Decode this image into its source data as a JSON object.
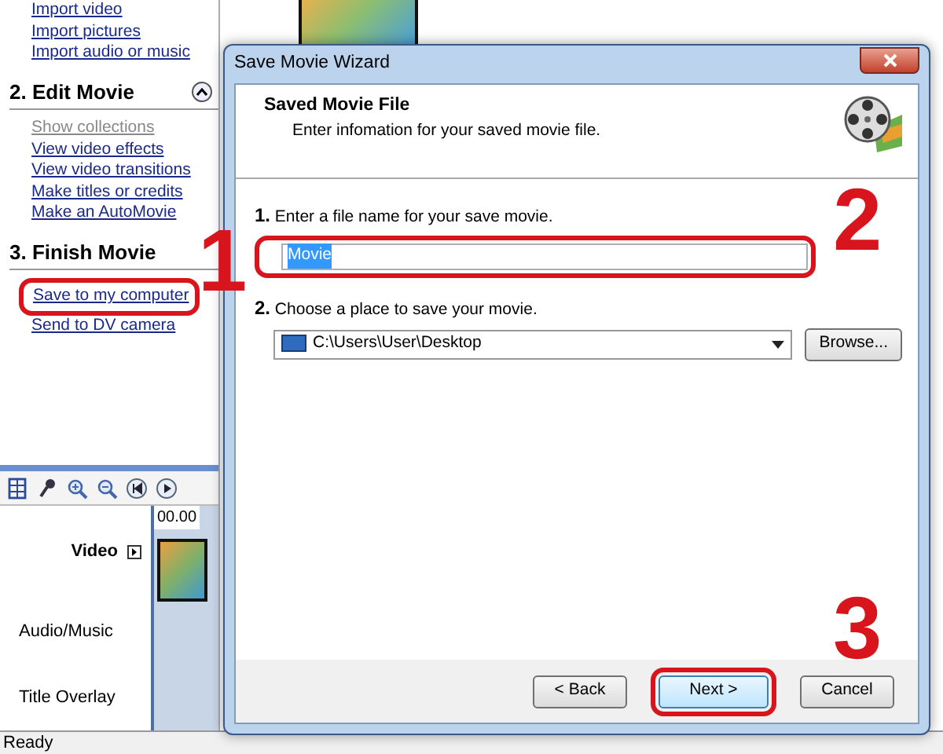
{
  "task_pane": {
    "sections": [
      {
        "items": [
          {
            "label": "Import video",
            "disabled": false,
            "highlighted": false
          },
          {
            "label": "Import pictures",
            "disabled": false,
            "highlighted": false
          },
          {
            "label": "Import audio or music",
            "disabled": false,
            "highlighted": false
          }
        ]
      },
      {
        "title": "2. Edit Movie",
        "collapsible": true,
        "items": [
          {
            "label": "Show collections",
            "disabled": true,
            "highlighted": false
          },
          {
            "label": "View video effects",
            "disabled": false,
            "highlighted": false
          },
          {
            "label": "View video transitions",
            "disabled": false,
            "highlighted": false
          },
          {
            "label": "Make titles or credits",
            "disabled": false,
            "highlighted": false
          },
          {
            "label": "Make an AutoMovie",
            "disabled": false,
            "highlighted": false
          }
        ]
      },
      {
        "title": "3. Finish Movie",
        "collapsible": false,
        "items": [
          {
            "label": "Save to my computer",
            "disabled": false,
            "highlighted": true
          },
          {
            "label": "Send to DV camera",
            "disabled": false,
            "highlighted": false
          }
        ]
      }
    ]
  },
  "timeline": {
    "time": "00.00",
    "tracks": [
      {
        "label": "Video",
        "bold": true,
        "expandable": true,
        "has_clip": true
      },
      {
        "label": "Audio/Music",
        "bold": false,
        "expandable": false,
        "has_clip": false
      },
      {
        "label": "Title Overlay",
        "bold": false,
        "expandable": false,
        "has_clip": false
      }
    ]
  },
  "status_bar": "Ready",
  "dialog": {
    "title": "Save Movie Wizard",
    "header_title": "Saved Movie File",
    "header_subtitle": "Enter infomation for your saved movie file.",
    "steps": [
      {
        "number": "1.",
        "label": "Enter a file name for your save movie.",
        "kind": "text",
        "value": "Movie",
        "text_selected": true,
        "highlighted": true
      },
      {
        "number": "2.",
        "label": "Choose a place to save your movie.",
        "kind": "dropdown",
        "value": "C:\\Users\\User\\Desktop",
        "button": "Browse...",
        "highlighted": false
      }
    ],
    "buttons": [
      {
        "label": "< Back",
        "default": false,
        "highlighted": false
      },
      {
        "label": "Next >",
        "default": true,
        "highlighted": true
      },
      {
        "label": "Cancel",
        "default": false,
        "highlighted": false
      }
    ]
  },
  "annotations": [
    {
      "label": "1"
    },
    {
      "label": "2"
    },
    {
      "label": "3"
    }
  ]
}
